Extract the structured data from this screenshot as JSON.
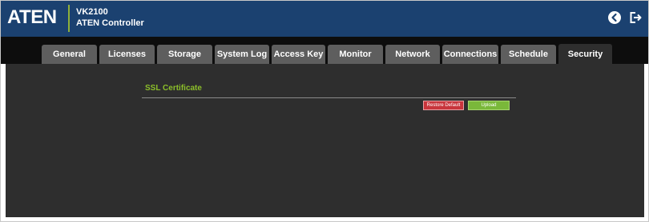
{
  "header": {
    "logo_text": "ATEN",
    "device_model": "VK2100",
    "device_name": "ATEN Controller",
    "icons": {
      "back": "circle-back-icon",
      "logout": "logout-icon"
    }
  },
  "tabs": [
    {
      "label": "General"
    },
    {
      "label": "Licenses"
    },
    {
      "label": "Storage"
    },
    {
      "label": "System Log"
    },
    {
      "label": "Access Key"
    },
    {
      "label": "Monitor"
    },
    {
      "label": "Network"
    },
    {
      "label": "Connections"
    },
    {
      "label": "Schedule"
    },
    {
      "label": "Security",
      "active": true
    }
  ],
  "ssl": {
    "title": "SSL Certificate",
    "restore_label": "Restore Default",
    "upload_label": "Upload"
  },
  "colors": {
    "header_bg": "#1b4170",
    "accent_green": "#8cbf2a",
    "restore_red": "#c8353c",
    "upload_green": "#7ab83a"
  }
}
